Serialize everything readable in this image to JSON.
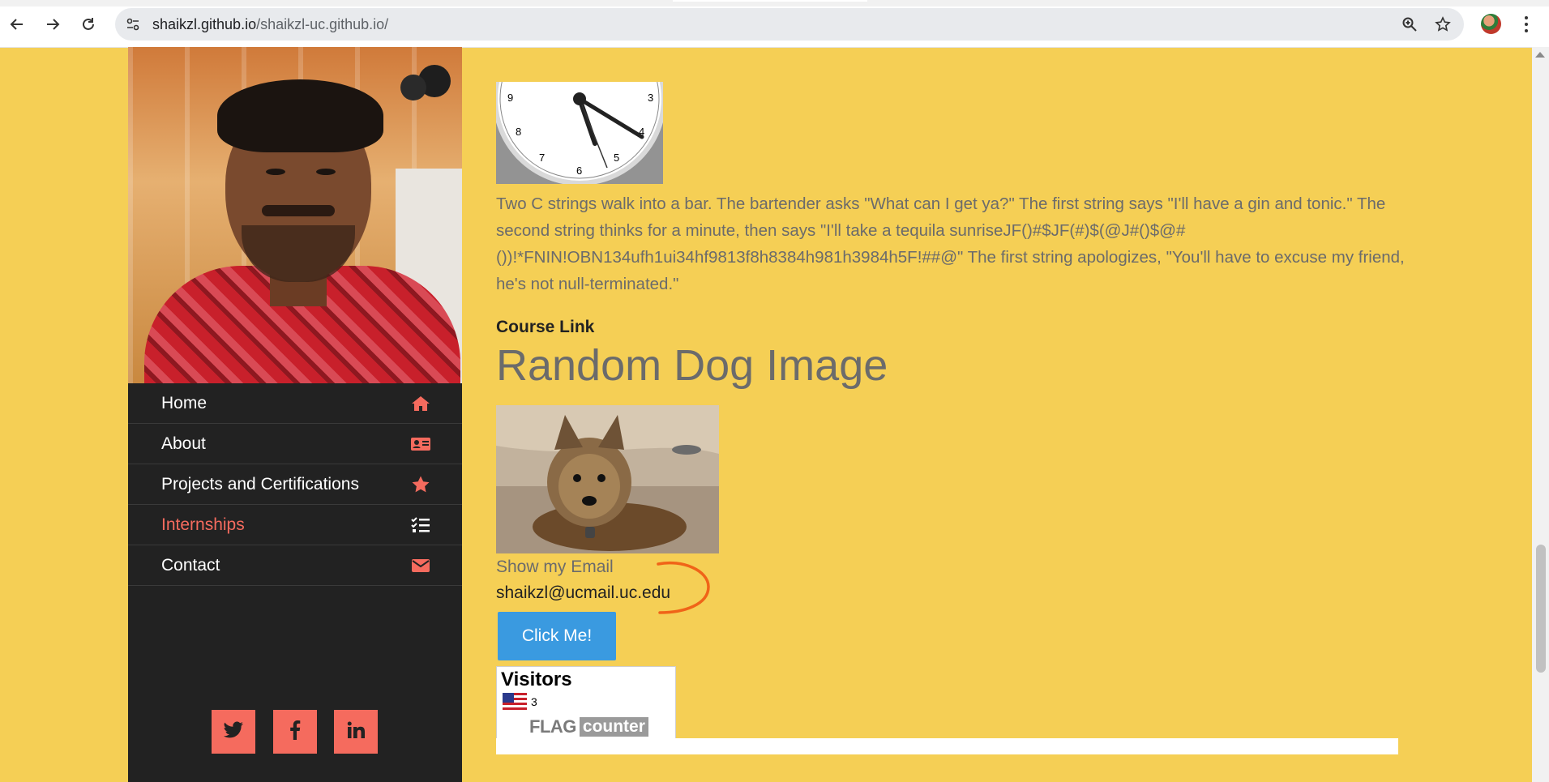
{
  "browser": {
    "url_host": "shaikzl.github.io",
    "url_path": "/shaikzl-uc.github.io/"
  },
  "sidebar": {
    "menu": [
      {
        "label": "Home",
        "icon": "home-icon",
        "active": false
      },
      {
        "label": "About",
        "icon": "id-card-icon",
        "active": false
      },
      {
        "label": "Projects and Certifications",
        "icon": "star-icon",
        "active": false
      },
      {
        "label": "Internships",
        "icon": "tasks-icon",
        "active": true
      },
      {
        "label": "Contact",
        "icon": "envelope-icon",
        "active": false
      }
    ],
    "social": [
      "twitter-icon",
      "facebook-icon",
      "linkedin-icon"
    ]
  },
  "main": {
    "clock_numbers": [
      "9",
      "3",
      "8",
      "4",
      "7",
      "5",
      "6"
    ],
    "joke": "Two C strings walk into a bar. The bartender asks \"What can I get ya?\" The first string says \"I'll have a gin and tonic.\" The second string thinks for a minute, then says \"I'll take a tequila sunriseJF()#$JF(#)$(@J#()$@#())!*FNIN!OBN134ufh1ui34hf9813f8h8384h981h3984h5F!##@\" The first string apologizes, \"You'll have to excuse my friend, he's not null-terminated.\"",
    "course_link": "Course Link",
    "dog_title": "Random Dog Image",
    "show_email": "Show my Email",
    "email_value": "shaikzl@ucmail.uc.edu",
    "click_button": "Click Me!",
    "visitors": {
      "title": "Visitors",
      "count": "3",
      "logo_flag": "FLAG",
      "logo_counter": "counter"
    }
  },
  "colors": {
    "page_bg": "#f5cf55",
    "sidebar_bg": "#222222",
    "accent": "#f56b5e",
    "button_blue": "#3a9ae0"
  }
}
